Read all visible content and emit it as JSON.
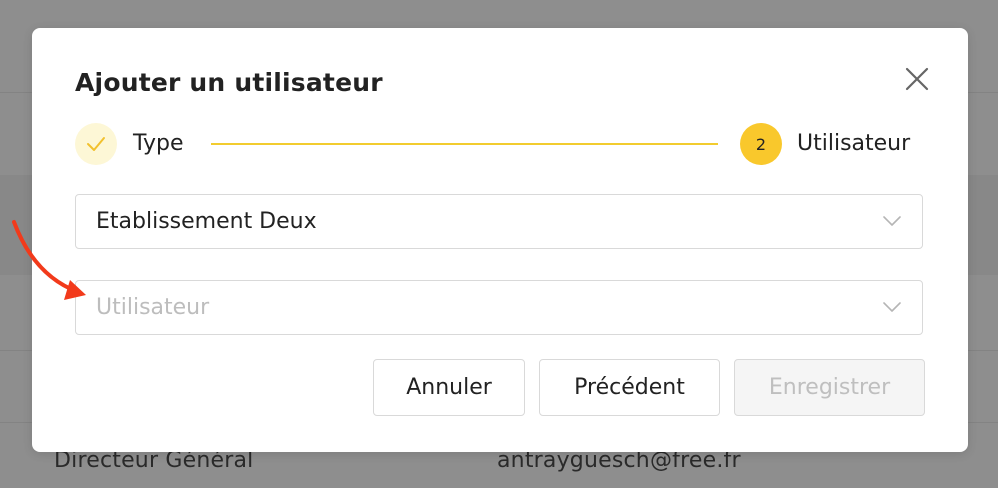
{
  "background": {
    "row_left": "Directeur Général",
    "row_right": "antrayguesch@free.fr"
  },
  "modal": {
    "title": "Ajouter un utilisateur",
    "close_icon": "close-icon"
  },
  "stepper": {
    "steps": [
      {
        "label": "Type",
        "status": "done",
        "icon": "check-icon"
      },
      {
        "number": "2",
        "label": "Utilisateur",
        "status": "active"
      }
    ],
    "accent_color": "#f9c82c"
  },
  "form": {
    "establishment_select": {
      "value": "Etablissement Deux"
    },
    "user_select": {
      "placeholder": "Utilisateur"
    }
  },
  "buttons": {
    "cancel": "Annuler",
    "previous": "Précédent",
    "save": "Enregistrer"
  },
  "annotation": {
    "color": "#f23a1b"
  }
}
